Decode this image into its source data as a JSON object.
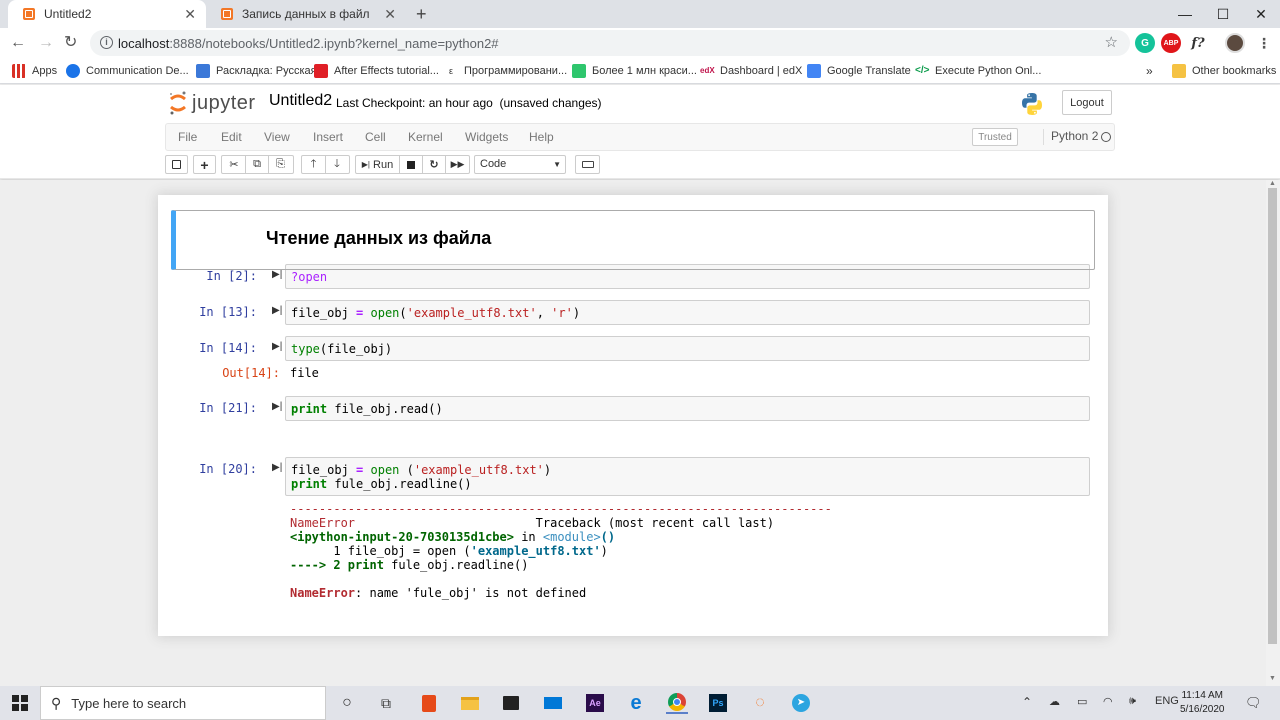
{
  "browser": {
    "tabs": [
      {
        "label": "Untitled2",
        "active": true,
        "icon": "jupyter-favicon-icon"
      },
      {
        "label": "Запись данных в файл",
        "active": false,
        "icon": "jupyter-favicon-icon"
      }
    ],
    "url_host": "localhost",
    "url_rest": ":8888/notebooks/Untitled2.ipynb?kernel_name=python2#",
    "bookmarks": [
      {
        "label": "Apps",
        "icon": "apps-grid-icon"
      },
      {
        "label": "Communication De...",
        "icon": "globe-icon"
      },
      {
        "label": "Раскладка: Русская",
        "icon": "keyboard-icon"
      },
      {
        "label": "After Effects tutorial...",
        "icon": "adobe-icon"
      },
      {
        "label": "Программировани...",
        "icon": "letter-e-icon"
      },
      {
        "label": "Более 1 млн краси...",
        "icon": "px-icon"
      },
      {
        "label": "Dashboard | edX",
        "icon": "edx-icon"
      },
      {
        "label": "Google Translate",
        "icon": "translate-icon"
      },
      {
        "label": "Execute Python Onl...",
        "icon": "code-icon"
      }
    ],
    "overflow_label": "»",
    "other_bookmarks": "Other bookmarks"
  },
  "jupyter": {
    "logo_text": "jupyter",
    "notebook_name": "Untitled2",
    "checkpoint_label": "Last Checkpoint:",
    "checkpoint_time": "an hour ago",
    "unsaved": "(unsaved changes)",
    "logout": "Logout",
    "menu": [
      "File",
      "Edit",
      "View",
      "Insert",
      "Cell",
      "Kernel",
      "Widgets",
      "Help"
    ],
    "trusted": "Trusted",
    "kernel": "Python 2",
    "toolbar": {
      "run_label": "Run",
      "cell_type": "Code"
    }
  },
  "notebook": {
    "heading": "Чтение данных из файла",
    "cells": [
      {
        "prompt": "In [2]:",
        "code": "?open"
      },
      {
        "prompt": "In [13]:",
        "code": "file_obj = open('example_utf8.txt', 'r')"
      },
      {
        "prompt": "In [14]:",
        "code": "type(file_obj)",
        "out_prompt": "Out[14]:",
        "output": "file"
      },
      {
        "prompt": "In [21]:",
        "code": "print file_obj.read()"
      },
      {
        "prompt": "In [20]:",
        "code_line1": "file_obj = open ('example_utf8.txt')",
        "code_line2": "print fule_obj.readline()"
      }
    ],
    "traceback": {
      "dashes": "---------------------------------------------------------------------------",
      "error_name": "NameError",
      "traceback_header": "Traceback (most recent call last)",
      "input_ref": "<ipython-input-20-7030135d1cbe>",
      "in_word": " in ",
      "module": "<module>",
      "module_parens": "()",
      "line1_num": "      1 ",
      "line1_code": "file_obj = open (",
      "line1_str": "'example_utf8.txt'",
      "line1_end": ")",
      "arrow": "----> 2 ",
      "line2_kw": "print",
      "line2_code": " fule_obj.readline()",
      "final_msg": ": name 'fule_obj' is not defined"
    }
  },
  "taskbar": {
    "search_placeholder": "Type here to search",
    "lang": "ENG",
    "time": "11:14 AM",
    "date": "5/16/2020"
  }
}
